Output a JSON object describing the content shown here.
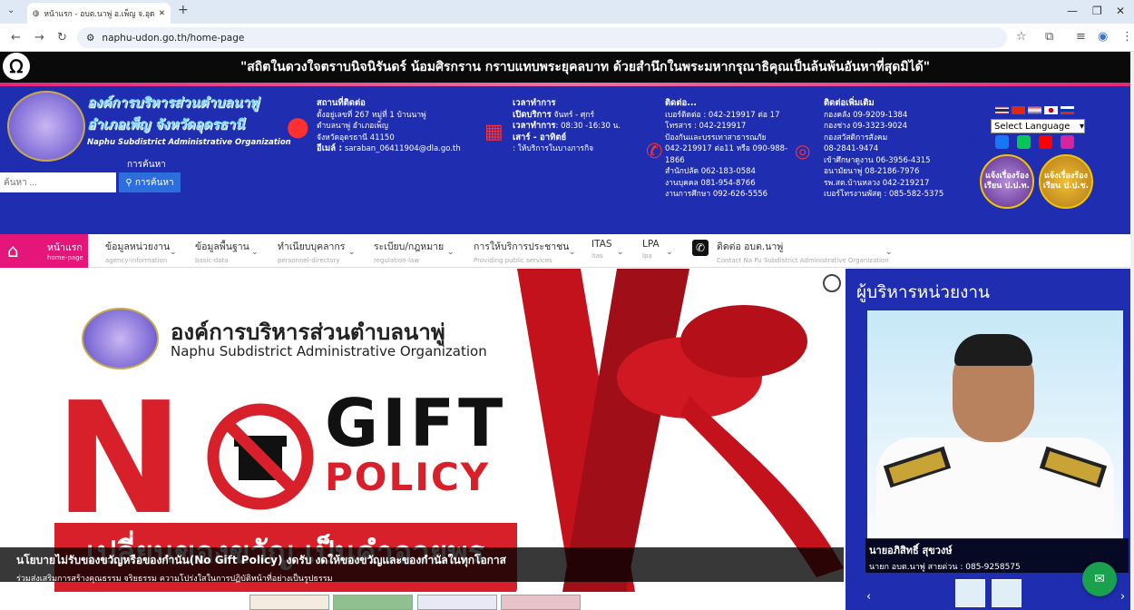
{
  "browser": {
    "tab_title": "หน้าแรก - อบต.นาพู่ อ.เพ็ญ จ.อุดร",
    "url": "naphu-udon.go.th/home-page"
  },
  "announcement": "\"สถิตในดวงใจตราบนิจนิรันดร์ น้อมศิรกราน กราบแทบพระยุคลบาท ด้วยสำนึกในพระมหากรุณาธิคุณเป็นล้นพ้นอันหาที่สุดมิได้\"",
  "header": {
    "org_th_line1": "องค์การบริหารส่วนตำบลนาพู่",
    "org_th_line2": "อำเภอเพ็ญ จังหวัดอุดรธานี",
    "org_en": "Naphu Subdistrict Administrative Organization",
    "search_label": "การค้นหา",
    "search_placeholder": "ค้นหา ...",
    "search_button": "การค้นหา",
    "address": {
      "title": "สถานที่ติดต่อ",
      "lines": [
        "ตั้งอยู่เลขที่ 267 หมู่ที่ 1 บ้านนาพู่",
        "ตำบลนาพู่ อำเภอเพ็ญ",
        "จังหวัดอุดรธานี 41150"
      ],
      "email_label": "อีเมล์ :",
      "email": "saraban_06411904@dla.go.th"
    },
    "hours": {
      "title": "เวลาทำการ",
      "open_label": "เปิดบริการ",
      "open_value": "จันทร์ - ศุกร์",
      "time_label": "เวลาทำการ",
      "time_value": ": 08:30 -16:30 น.",
      "weekend_label": "เสาร์ - อาทิตย์",
      "weekend_value": ": ให้บริการในบางภารกิจ"
    },
    "contact": {
      "title": "ติดต่อ...",
      "lines": [
        "เบอร์ติดต่อ : 042-219917 ต่อ 17",
        "โทรสาร : 042-219917",
        "ป้องกันและบรรเทาสาธารณภัย",
        "042-219917 ต่อ11 หรือ 090-988-",
        "1866",
        "สำนักปลัด 062-183-0584",
        "งานบุคคล 081-954-8766",
        "งานการศึกษา 092-626-5556"
      ]
    },
    "contact_more": {
      "title": "ติดต่อเพิ่มเติม",
      "lines": [
        "กองคลัง 09-9209-1384",
        "กองช่าง 09-3323-9024",
        "กองสวัสดิการสังคม",
        "08-2841-9474",
        "เข้าศึกษาดูงาน 06-3956-4315",
        "อนามัยนาพู่ 08-2186-7976",
        "รพ.สต.บ้านหลวง 042-219217",
        "เบอร์โทรงานพัสดุ : 085-582-5375"
      ]
    },
    "language_select": "Select Language",
    "badge1": "แจ้งเรื่องร้องเรียน ป.ป.ท.",
    "badge2": "แจ้งเรื่องร้องเรียน ป.ป.ช."
  },
  "nav": {
    "home": {
      "label": "หน้าแรก",
      "sub": "home-page"
    },
    "items": [
      {
        "label": "ข้อมูลหน่วยงาน",
        "sub": "agency-information"
      },
      {
        "label": "ข้อมูลพื้นฐาน",
        "sub": "basic-data"
      },
      {
        "label": "ทำเนียบบุคลากร",
        "sub": "personnel-directory"
      },
      {
        "label": "ระเบียบ/กฎหมาย",
        "sub": "regulation-law"
      },
      {
        "label": "การให้บริการประชาชน",
        "sub": "Providing public services"
      },
      {
        "label": "ITAS",
        "sub": "itas"
      },
      {
        "label": "LPA",
        "sub": "lpa"
      },
      {
        "label": "ติดต่อ อบต.นาพู่",
        "sub": "Contact Na Pu Subdistrict Administrative Organization"
      }
    ]
  },
  "banner": {
    "org_th": "องค์การบริหารส่วนตำบลนาพู่",
    "org_en": "Naphu Subdistrict Administrative Organization",
    "no_letter": "N",
    "gift": "GIFT",
    "policy": "POLICY",
    "red_text": "เปลี่ยนของขวัญ เป็นคำอวยพร",
    "caption_title": "นโยบายไม่รับของขวัญหรือของกำนัน(No Gift Policy) งดรับ งดให้ของขวัญและของกำนัลในทุกโอกาส",
    "caption_sub": "ร่วมส่งเสริมการสร้างคุณธรรม จริยธรรม ความโปร่งใสในการปฏิบัติหน้าที่อย่างเป็นรูปธรรม"
  },
  "sidebar": {
    "title": "ผู้บริหารหน่วยงาน",
    "name": "นายอภิสิทธิ์ สุขวงษ์",
    "position": "นายก อบต.นาพู่ สายด่วน : 085-9258575"
  },
  "colors": {
    "header_blue": "#1f2db1",
    "accent_pink": "#e6157a",
    "brand_red": "#d8202a"
  }
}
